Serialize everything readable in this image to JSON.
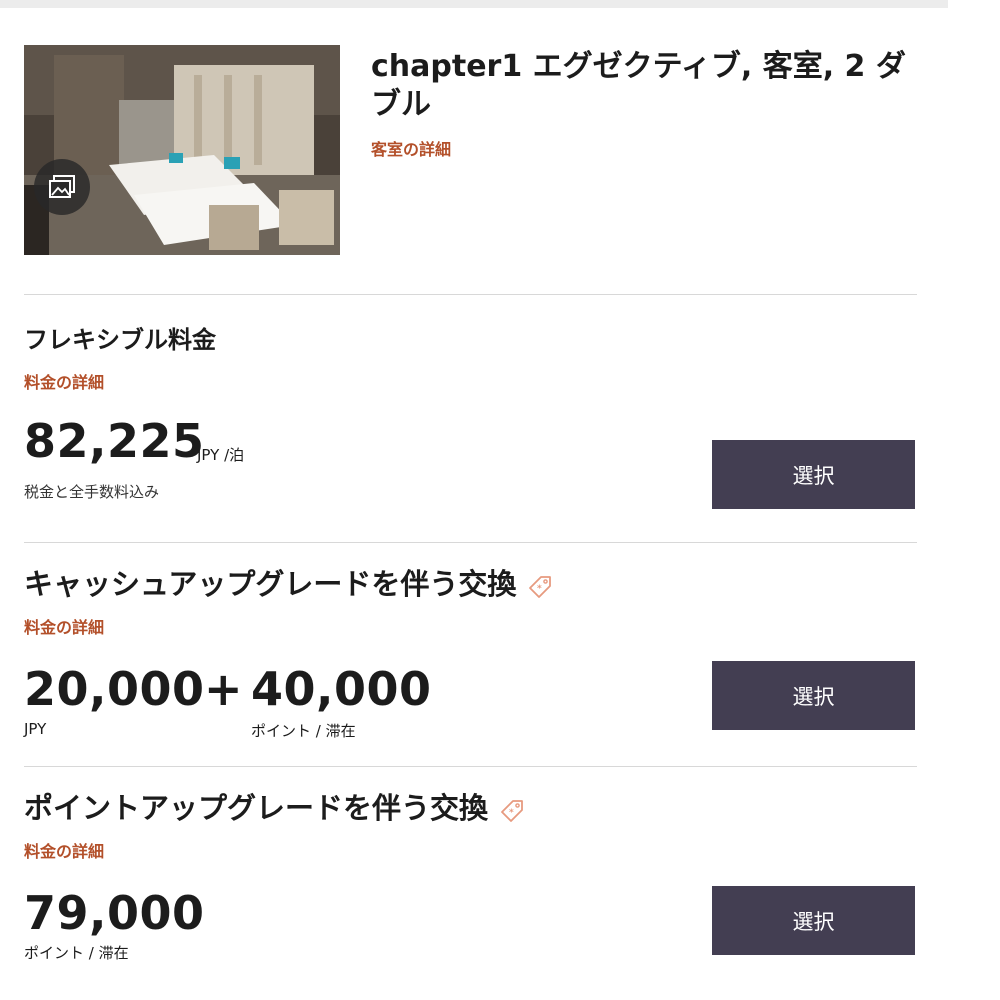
{
  "room": {
    "title": "chapter1 エグゼクティブ, 客室, 2 ダブル",
    "detail_link": "客室の詳細",
    "photo_icon": "gallery-icon"
  },
  "rates": [
    {
      "name": "フレキシブル料金",
      "detail_link": "料金の詳細",
      "price": "82,225",
      "unit": "JPY /泊",
      "note": "税金と全手数料込み",
      "select_label": "選択"
    },
    {
      "name": "キャッシュアップグレードを伴う交換",
      "tag_icon": "tag-icon",
      "detail_link": "料金の詳細",
      "cash": "20,000",
      "plus": "+",
      "points": "40,000",
      "cash_unit": "JPY",
      "points_unit": "ポイント / 滞在",
      "select_label": "選択"
    },
    {
      "name": "ポイントアップグレードを伴う交換",
      "tag_icon": "tag-icon",
      "detail_link": "料金の詳細",
      "points": "79,000",
      "points_unit": "ポイント / 滞在",
      "select_label": "選択"
    }
  ],
  "colors": {
    "accent": "#b3502a",
    "button": "#433e52",
    "divider": "#d8d8d8"
  }
}
